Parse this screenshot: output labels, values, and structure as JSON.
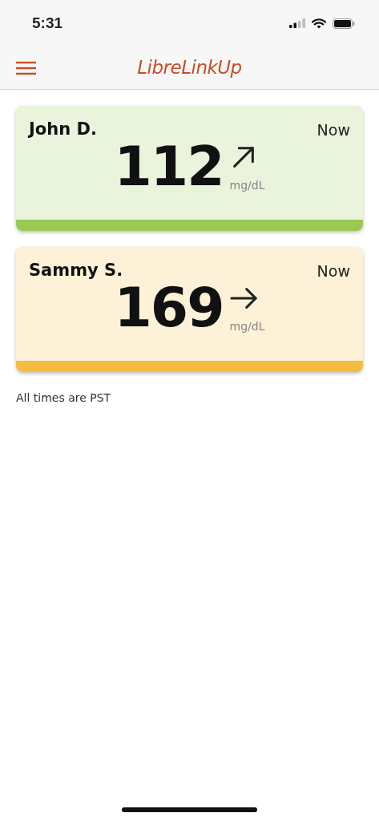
{
  "status_bar": {
    "time": "5:31"
  },
  "header": {
    "title": "LibreLinkUp"
  },
  "readings": [
    {
      "name": "John D.",
      "time": "Now",
      "value": "112",
      "unit": "mg/dL",
      "kind": "rising",
      "color": "#9bc853"
    },
    {
      "name": "Sammy S.",
      "time": "Now",
      "value": "169",
      "unit": "mg/dL",
      "kind": "steady",
      "color": "#f4bd41"
    }
  ],
  "footnote": "All times are PST"
}
